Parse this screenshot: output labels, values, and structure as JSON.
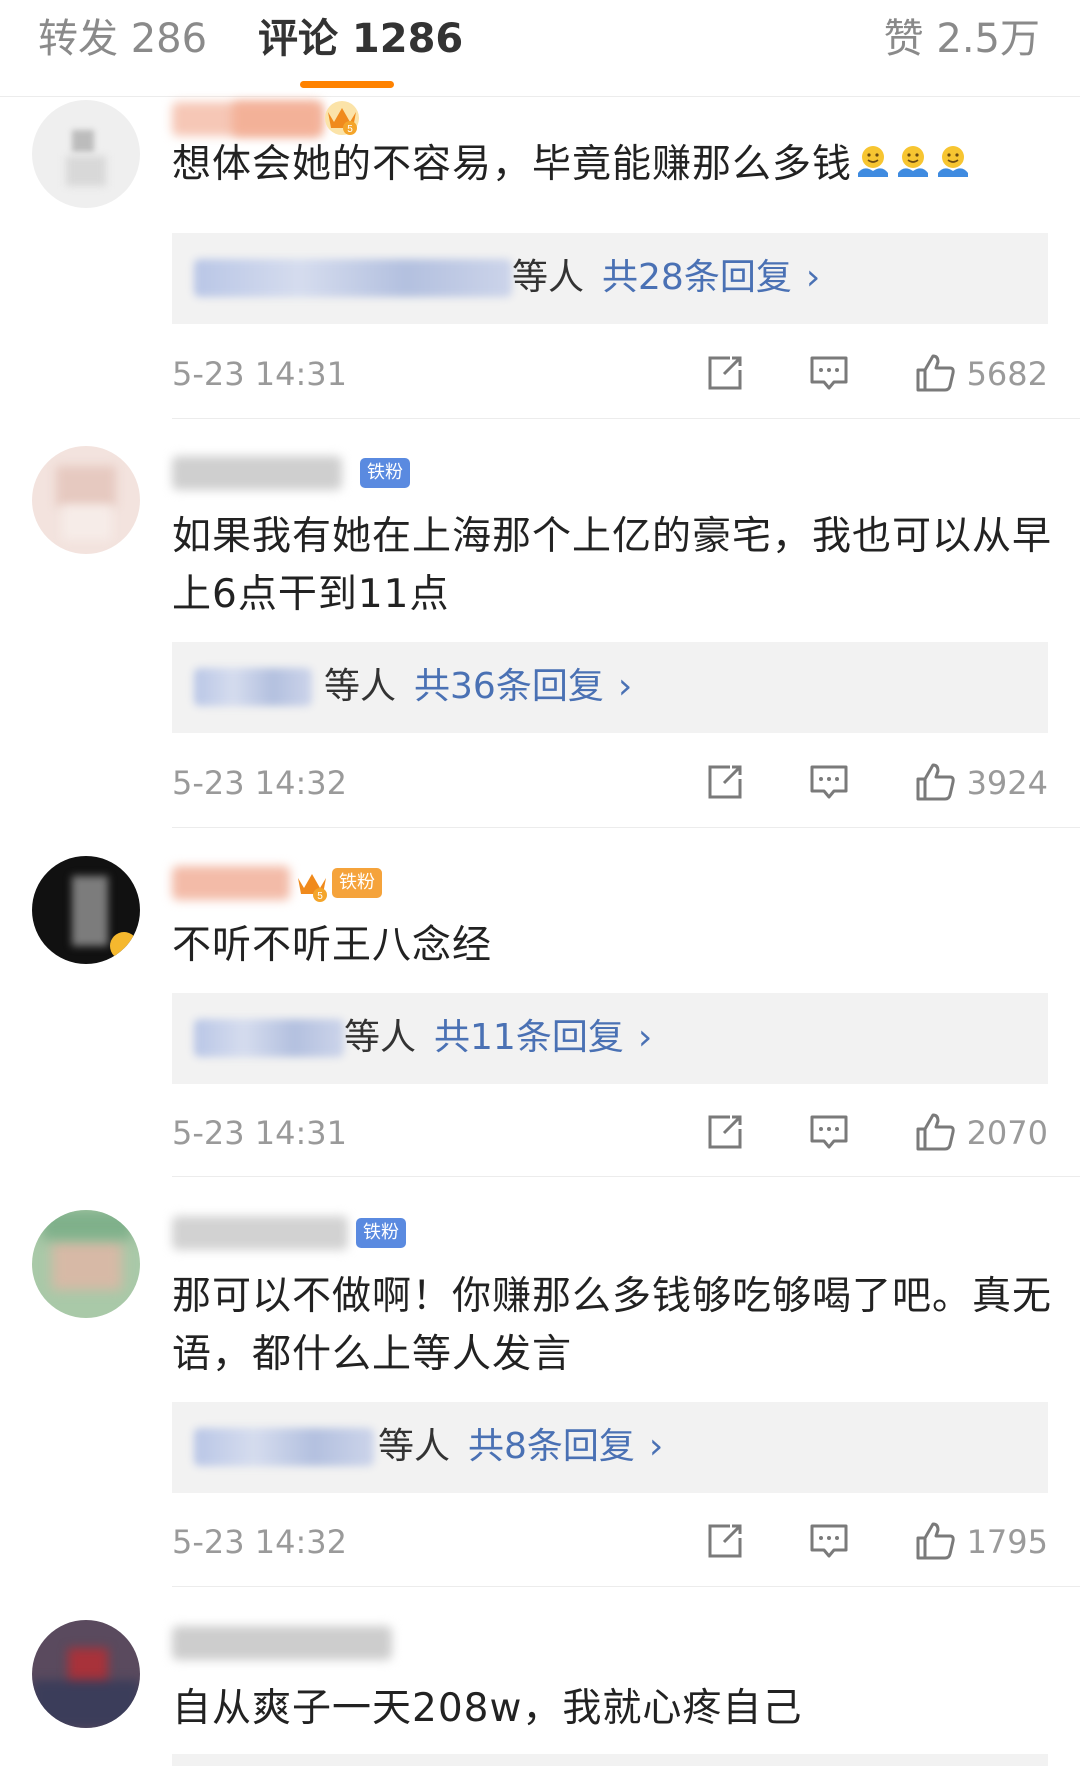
{
  "tabs": {
    "repost": "转发 286",
    "comment": "评论 1286",
    "like": "赞 2.5万"
  },
  "colors": {
    "accent": "#ff8200",
    "link": "#4a71b4",
    "fan_badge": "#5a8ae0",
    "gold_badge": "#f5a33b"
  },
  "comments": [
    {
      "text": "想体会她的不容易，毕竟能赚那么多钱",
      "emoji_icons": [
        "hug-emoji",
        "hug-emoji",
        "hug-emoji"
      ],
      "reply_who": "等人",
      "reply_count": "共28条回复",
      "time": "5-23 14:31",
      "likes": "5682"
    },
    {
      "badge": "铁粉",
      "text": "如果我有她在上海那个上亿的豪宅，我也可以从早上6点干到11点",
      "reply_who": "等人",
      "reply_count": "共36条回复",
      "time": "5-23 14:32",
      "likes": "3924"
    },
    {
      "badge": "铁粉",
      "text": "不听不听王八念经",
      "reply_who": "等人",
      "reply_count": "共11条回复",
      "time": "5-23 14:31",
      "likes": "2070"
    },
    {
      "badge": "铁粉",
      "text": "那可以不做啊！你赚那么多钱够吃够喝了吧。真无语，都什么上等人发言",
      "reply_who": "等人",
      "reply_count": "共8条回复",
      "time": "5-23 14:32",
      "likes": "1795"
    },
    {
      "text": "自从爽子一天208w，我就心疼自己"
    }
  ],
  "chevron": "›"
}
